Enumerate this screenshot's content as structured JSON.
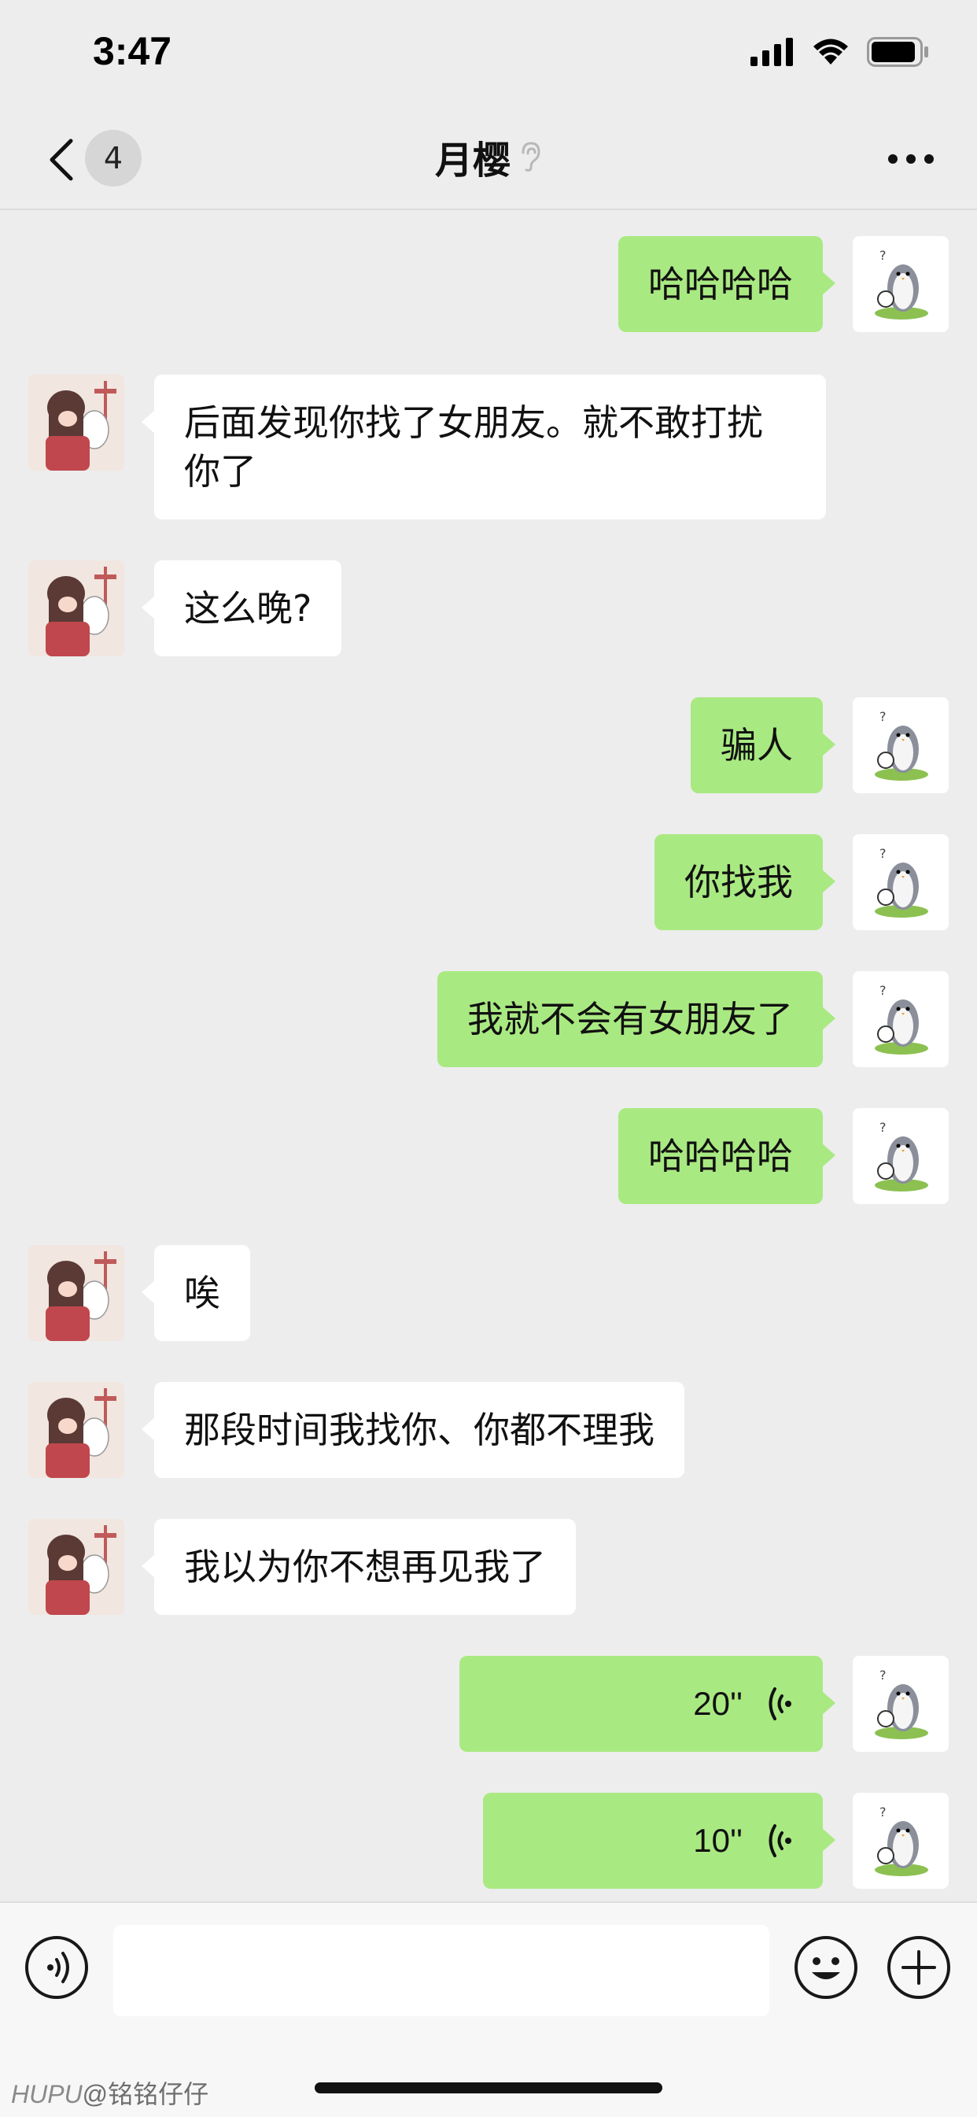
{
  "status_bar": {
    "time": "3:47"
  },
  "nav": {
    "unread_count": "4",
    "title": "月樱",
    "title_icon": "ear-icon",
    "more_icon": "more-icon"
  },
  "colors": {
    "sent_bubble": "#a9e982",
    "received_bubble": "#ffffff",
    "background": "#ededed"
  },
  "messages": [
    {
      "side": "right",
      "type": "text",
      "text": "哈哈哈哈"
    },
    {
      "side": "left",
      "type": "text",
      "text": "后面发现你找了女朋友。就不敢打扰你了"
    },
    {
      "side": "left",
      "type": "text",
      "text": "这么晚?"
    },
    {
      "side": "right",
      "type": "text",
      "text": "骗人"
    },
    {
      "side": "right",
      "type": "text",
      "text": "你找我"
    },
    {
      "side": "right",
      "type": "text",
      "text": "我就不会有女朋友了"
    },
    {
      "side": "right",
      "type": "text",
      "text": "哈哈哈哈"
    },
    {
      "side": "left",
      "type": "text",
      "text": "唉"
    },
    {
      "side": "left",
      "type": "text",
      "text": "那段时间我找你、你都不理我"
    },
    {
      "side": "left",
      "type": "text",
      "text": "我以为你不想再见我了"
    },
    {
      "side": "right",
      "type": "voice",
      "text": "20''"
    },
    {
      "side": "right",
      "type": "voice",
      "text": "10''"
    }
  ],
  "input_bar": {
    "voice_icon": "voice-toggle-icon",
    "emoji_icon": "emoji-icon",
    "plus_icon": "plus-icon"
  },
  "watermark": {
    "brand": "HUPU",
    "user": "@铭铭仔仔"
  }
}
